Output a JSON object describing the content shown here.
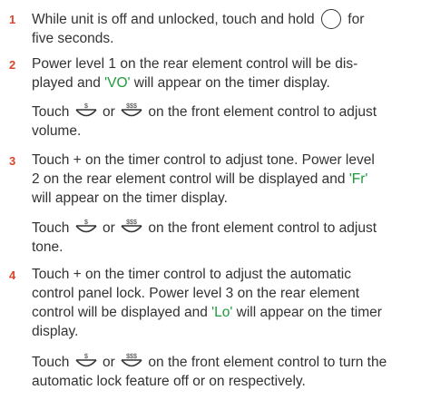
{
  "steps": [
    {
      "number": "1",
      "p1_before": "While unit is off and unlocked, touch and hold",
      "p1_after": "for",
      "p1_line2": "five seconds."
    },
    {
      "number": "2",
      "p1_line1": "Power level 1 on the rear element control will be dis-",
      "p1_line2_before": "played and ",
      "p1_code": "'VO'",
      "p1_line2_after": " will appear on the timer display.",
      "p2_touch": "Touch",
      "p2_or": "or",
      "p2_line1_after": "on the front element control to adjust",
      "p2_line2": "volume."
    },
    {
      "number": "3",
      "p1_line1": "Touch + on the timer control to adjust tone. Power level",
      "p1_line2": "2 on the rear element control will be displayed and ",
      "p1_code": "'Fr'",
      "p1_line3": "will appear on the timer display.",
      "p2_touch": "Touch",
      "p2_or": "or",
      "p2_line1_after": "on the front element control to adjust",
      "p2_line2": "tone."
    },
    {
      "number": "4",
      "p1_line1": "Touch + on the timer control to adjust the automatic",
      "p1_line2": "control panel lock. Power level 3 on the rear element",
      "p1_line3_before": "control will be displayed and ",
      "p1_code": "'Lo'",
      "p1_line3_after": " will appear on the timer",
      "p1_line4": "display.",
      "p2_touch": "Touch",
      "p2_or": "or",
      "p2_line1_after": "on the front element control to turn the",
      "p2_line2": "automatic lock feature off or on respectively."
    }
  ],
  "icons": {
    "low_sym": "$",
    "high_sym": "$$$"
  },
  "colors": {
    "step_number": "#d9462b",
    "code": "#1e9a3a",
    "text": "#333333"
  }
}
